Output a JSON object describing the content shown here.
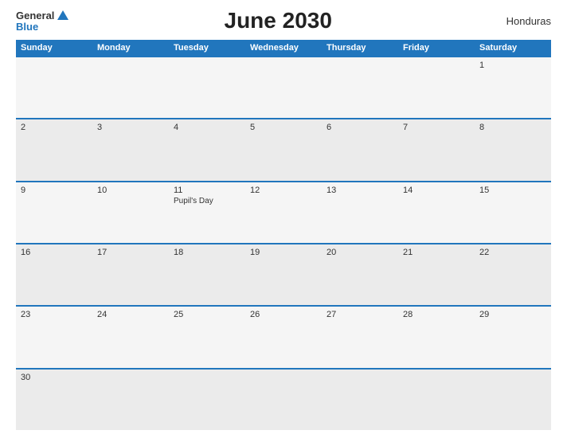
{
  "header": {
    "logo_general": "General",
    "logo_blue": "Blue",
    "title": "June 2030",
    "country": "Honduras"
  },
  "weekdays": [
    "Sunday",
    "Monday",
    "Tuesday",
    "Wednesday",
    "Thursday",
    "Friday",
    "Saturday"
  ],
  "weeks": [
    [
      {
        "day": "",
        "event": ""
      },
      {
        "day": "",
        "event": ""
      },
      {
        "day": "",
        "event": ""
      },
      {
        "day": "",
        "event": ""
      },
      {
        "day": "",
        "event": ""
      },
      {
        "day": "",
        "event": ""
      },
      {
        "day": "1",
        "event": ""
      }
    ],
    [
      {
        "day": "2",
        "event": ""
      },
      {
        "day": "3",
        "event": ""
      },
      {
        "day": "4",
        "event": ""
      },
      {
        "day": "5",
        "event": ""
      },
      {
        "day": "6",
        "event": ""
      },
      {
        "day": "7",
        "event": ""
      },
      {
        "day": "8",
        "event": ""
      }
    ],
    [
      {
        "day": "9",
        "event": ""
      },
      {
        "day": "10",
        "event": ""
      },
      {
        "day": "11",
        "event": "Pupil's Day"
      },
      {
        "day": "12",
        "event": ""
      },
      {
        "day": "13",
        "event": ""
      },
      {
        "day": "14",
        "event": ""
      },
      {
        "day": "15",
        "event": ""
      }
    ],
    [
      {
        "day": "16",
        "event": ""
      },
      {
        "day": "17",
        "event": ""
      },
      {
        "day": "18",
        "event": ""
      },
      {
        "day": "19",
        "event": ""
      },
      {
        "day": "20",
        "event": ""
      },
      {
        "day": "21",
        "event": ""
      },
      {
        "day": "22",
        "event": ""
      }
    ],
    [
      {
        "day": "23",
        "event": ""
      },
      {
        "day": "24",
        "event": ""
      },
      {
        "day": "25",
        "event": ""
      },
      {
        "day": "26",
        "event": ""
      },
      {
        "day": "27",
        "event": ""
      },
      {
        "day": "28",
        "event": ""
      },
      {
        "day": "29",
        "event": ""
      }
    ],
    [
      {
        "day": "30",
        "event": ""
      },
      {
        "day": "",
        "event": ""
      },
      {
        "day": "",
        "event": ""
      },
      {
        "day": "",
        "event": ""
      },
      {
        "day": "",
        "event": ""
      },
      {
        "day": "",
        "event": ""
      },
      {
        "day": "",
        "event": ""
      }
    ]
  ]
}
